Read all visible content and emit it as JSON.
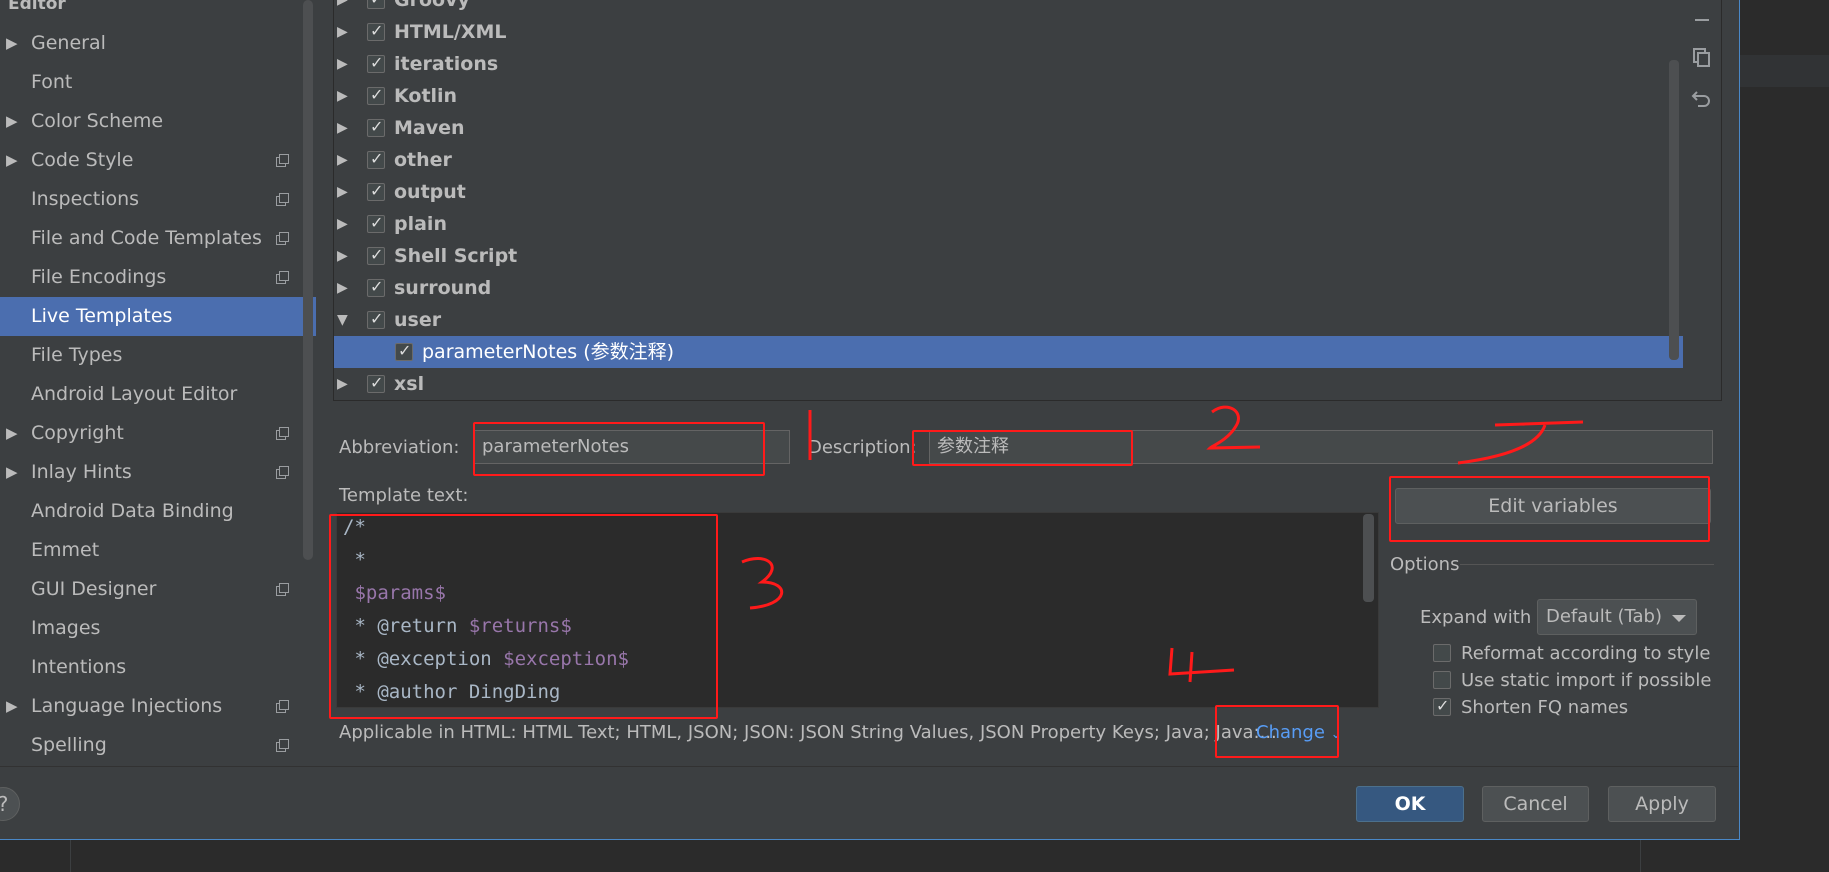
{
  "sidebar": {
    "heading": "Editor",
    "items": [
      {
        "label": "General",
        "expandable": true,
        "project_icon": false,
        "selected": false
      },
      {
        "label": "Font",
        "expandable": false,
        "project_icon": false,
        "selected": false
      },
      {
        "label": "Color Scheme",
        "expandable": true,
        "project_icon": false,
        "selected": false
      },
      {
        "label": "Code Style",
        "expandable": true,
        "project_icon": true,
        "selected": false
      },
      {
        "label": "Inspections",
        "expandable": false,
        "project_icon": true,
        "selected": false
      },
      {
        "label": "File and Code Templates",
        "expandable": false,
        "project_icon": true,
        "selected": false
      },
      {
        "label": "File Encodings",
        "expandable": false,
        "project_icon": true,
        "selected": false
      },
      {
        "label": "Live Templates",
        "expandable": false,
        "project_icon": false,
        "selected": true
      },
      {
        "label": "File Types",
        "expandable": false,
        "project_icon": false,
        "selected": false
      },
      {
        "label": "Android Layout Editor",
        "expandable": false,
        "project_icon": false,
        "selected": false
      },
      {
        "label": "Copyright",
        "expandable": true,
        "project_icon": true,
        "selected": false
      },
      {
        "label": "Inlay Hints",
        "expandable": true,
        "project_icon": true,
        "selected": false
      },
      {
        "label": "Android Data Binding",
        "expandable": false,
        "project_icon": false,
        "selected": false
      },
      {
        "label": "Emmet",
        "expandable": false,
        "project_icon": false,
        "selected": false
      },
      {
        "label": "GUI Designer",
        "expandable": false,
        "project_icon": true,
        "selected": false
      },
      {
        "label": "Images",
        "expandable": false,
        "project_icon": false,
        "selected": false
      },
      {
        "label": "Intentions",
        "expandable": false,
        "project_icon": false,
        "selected": false
      },
      {
        "label": "Language Injections",
        "expandable": true,
        "project_icon": true,
        "selected": false
      },
      {
        "label": "Spelling",
        "expandable": false,
        "project_icon": true,
        "selected": false
      }
    ]
  },
  "tree": {
    "rows": [
      {
        "label": "Groovy",
        "checked": true,
        "expanded": false,
        "child": false,
        "selected": false
      },
      {
        "label": "HTML/XML",
        "checked": true,
        "expanded": false,
        "child": false,
        "selected": false
      },
      {
        "label": "iterations",
        "checked": true,
        "expanded": false,
        "child": false,
        "selected": false
      },
      {
        "label": "Kotlin",
        "checked": true,
        "expanded": false,
        "child": false,
        "selected": false
      },
      {
        "label": "Maven",
        "checked": true,
        "expanded": false,
        "child": false,
        "selected": false
      },
      {
        "label": "other",
        "checked": true,
        "expanded": false,
        "child": false,
        "selected": false
      },
      {
        "label": "output",
        "checked": true,
        "expanded": false,
        "child": false,
        "selected": false
      },
      {
        "label": "plain",
        "checked": true,
        "expanded": false,
        "child": false,
        "selected": false
      },
      {
        "label": "Shell Script",
        "checked": true,
        "expanded": false,
        "child": false,
        "selected": false
      },
      {
        "label": "surround",
        "checked": true,
        "expanded": false,
        "child": false,
        "selected": false
      },
      {
        "label": "user",
        "checked": true,
        "expanded": true,
        "child": false,
        "selected": false
      },
      {
        "label": "parameterNotes (参数注释)",
        "checked": true,
        "expanded": false,
        "child": true,
        "selected": true
      },
      {
        "label": "xsl",
        "checked": true,
        "expanded": false,
        "child": false,
        "selected": false
      }
    ]
  },
  "toolbar": {
    "icons": [
      "minus-icon",
      "copy-icon",
      "undo-icon"
    ]
  },
  "form": {
    "abbreviation_label": "Abbreviation:",
    "abbreviation_value": "parameterNotes",
    "description_label": "Description:",
    "description_value": "参数注释",
    "template_text_label": "Template text:",
    "template_lines": [
      [
        {
          "t": "/*",
          "v": false
        }
      ],
      [
        {
          "t": " *",
          "v": false
        }
      ],
      [
        {
          "t": " ",
          "v": false
        },
        {
          "t": "$params$",
          "v": true
        }
      ],
      [
        {
          "t": " * @return ",
          "v": false
        },
        {
          "t": "$returns$",
          "v": true
        }
      ],
      [
        {
          "t": " * @exception ",
          "v": false
        },
        {
          "t": "$exception$",
          "v": true
        }
      ],
      [
        {
          "t": " * @author DingDing",
          "v": false
        }
      ]
    ],
    "edit_variables_label": "Edit variables",
    "options_label": "Options",
    "expand_with_label": "Expand with",
    "expand_with_value": "Default (Tab)",
    "options": [
      {
        "label": "Reformat according to style",
        "checked": false
      },
      {
        "label": "Use static import if possible",
        "checked": false
      },
      {
        "label": "Shorten FQ names",
        "checked": true
      }
    ],
    "applicable_text": "Applicable in HTML: HTML Text; HTML, JSON; JSON: JSON String Values, JSON Property Keys; Java; Java:...",
    "change_label": "Change"
  },
  "buttons": {
    "help": "?",
    "ok": "OK",
    "cancel": "Cancel",
    "apply": "Apply"
  },
  "annotations": {
    "colors": {
      "accent": "#ff1a1a",
      "selection": "#4b6eaf",
      "primary_button": "#365880",
      "link": "#589df6"
    }
  }
}
